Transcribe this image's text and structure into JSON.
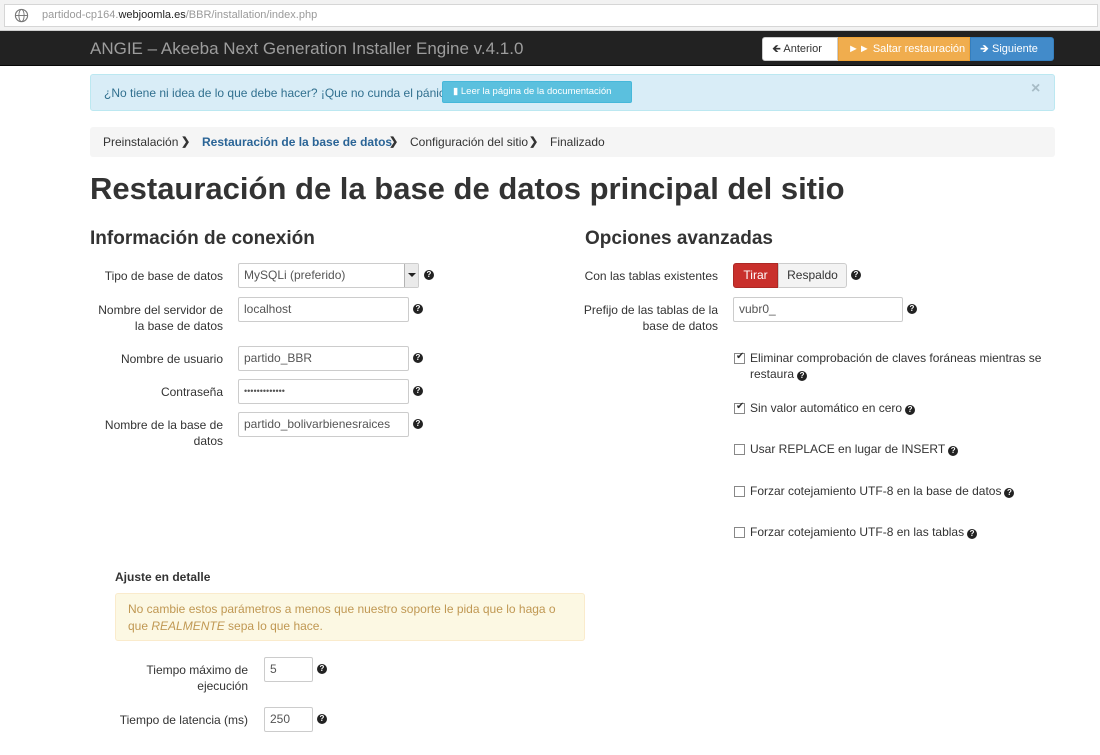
{
  "browser": {
    "url_prefix": "partidod-cp164.",
    "url_domain": "webjoomla.es",
    "url_path": "/BBR/installation/index.php"
  },
  "header": {
    "title": "ANGIE – Akeeba Next Generation Installer Engine v.4.1.0",
    "prev_label": "Anterior",
    "skip_label": "Saltar restauración",
    "next_label": "Siguiente"
  },
  "alert": {
    "text": "¿No tiene ni idea de lo que debe hacer? ¡Que no cunda el pánico!",
    "doc_button": "Leer la página de la documentación",
    "close": "×"
  },
  "breadcrumb": [
    "Preinstalación",
    "Restauración de la base de datos",
    "Configuración del sitio",
    "Finalizado"
  ],
  "page_title": "Restauración de la base de datos principal del sitio",
  "connection": {
    "heading": "Información de conexión",
    "db_type_label": "Tipo de base de datos",
    "db_type_value": "MySQLi (preferido)",
    "host_label": "Nombre del servidor de la base de datos",
    "host_value": "localhost",
    "user_label": "Nombre de usuario",
    "user_value": "partido_BBR",
    "password_label": "Contraseña",
    "password_value": "•••••••••••••",
    "dbname_label": "Nombre de la base de datos",
    "dbname_value": "partido_bolivarbienesraices"
  },
  "advanced": {
    "heading": "Opciones avanzadas",
    "existing_label": "Con las tablas existentes",
    "drop_label": "Tirar",
    "backup_label": "Respaldo",
    "prefix_label": "Prefijo de las tablas de la base de datos",
    "prefix_value": "vubr0_",
    "options": [
      {
        "label": "Eliminar comprobación de claves foráneas mientras se restaura",
        "checked": true
      },
      {
        "label": "Sin valor automático en cero",
        "checked": true
      },
      {
        "label": "Usar REPLACE en lugar de INSERT",
        "checked": false
      },
      {
        "label": "Forzar cotejamiento UTF-8 en la base de datos",
        "checked": false
      },
      {
        "label": "Forzar cotejamiento UTF-8 en las tablas",
        "checked": false
      }
    ]
  },
  "fine_tuning": {
    "heading": "Ajuste en detalle",
    "warning_before": "No cambie estos parámetros a menos que nuestro soporte le pida que lo haga o que ",
    "warning_emph": "REALMENTE",
    "warning_after": " sepa lo que hace.",
    "max_exec_label": "Tiempo máximo de ejecución",
    "max_exec_value": "5",
    "latency_label": "Tiempo de latencia (ms)",
    "latency_value": "250"
  },
  "help_glyph": "?",
  "colors": {
    "navbar": "#222222",
    "warning_btn": "#f0ad4e",
    "primary_btn": "#428bca",
    "danger_btn": "#c9302c",
    "info_alert": "#d9edf7",
    "link": "#2a6496"
  }
}
